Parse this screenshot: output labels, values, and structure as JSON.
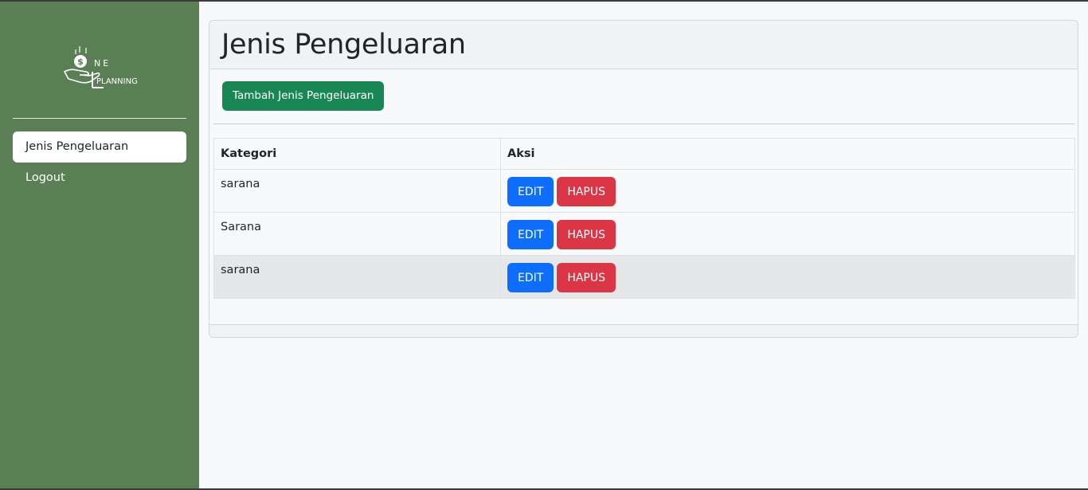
{
  "brand": {
    "logo_text_top": "NE",
    "logo_text_bottom": "PLANNING",
    "logo_initial": "O"
  },
  "sidebar": {
    "items": [
      {
        "label": "Jenis Pengeluaran",
        "active": true
      },
      {
        "label": "Logout",
        "active": false
      }
    ]
  },
  "main": {
    "title": "Jenis Pengeluaran",
    "add_button": "Tambah Jenis Pengeluaran",
    "table": {
      "headers": [
        "Kategori",
        "Aksi"
      ],
      "rows": [
        {
          "kategori": "sarana"
        },
        {
          "kategori": "Sarana"
        },
        {
          "kategori": "sarana"
        }
      ],
      "edit_label": "EDIT",
      "delete_label": "HAPUS"
    }
  },
  "colors": {
    "sidebar": "#5a7f55",
    "success": "#198754",
    "primary": "#0d6efd",
    "danger": "#dc3545"
  }
}
